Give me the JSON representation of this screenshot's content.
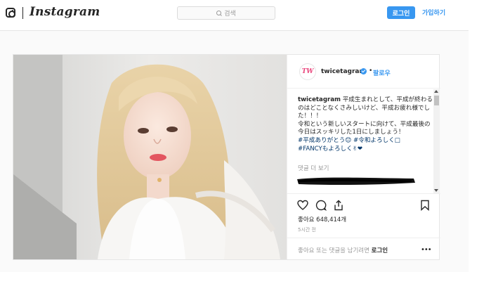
{
  "topbar": {
    "brand": "Instagram",
    "search_placeholder": "검색",
    "login_label": "로그인",
    "signup_label": "가입하기"
  },
  "post": {
    "avatar_text": "TW",
    "username": "twicetagram",
    "follow_label": "팔로우",
    "separator": "•",
    "caption": {
      "author": "twicetagram",
      "lines": [
        "平成生まれとして、平成が終わるのはどことなくさみしいけど、平成お疲れ様でした！！！",
        "令和という新しいスタートに向けて、平成最後の今日はスッキリした1日にしましょう！"
      ],
      "hashtag_line1": "#平成ありがとう😊 #令和よろしく□",
      "hashtag_line2": "#FANCYもよろしく✌❤"
    },
    "view_comments": "댓글 더 보기",
    "likes_text": "좋아요 648,414개",
    "time_ago": "5시간 전",
    "comment_prompt": "좋아요 또는 댓글을 남기려면",
    "comment_login": "로그인",
    "more_icon": "more-icon"
  },
  "colors": {
    "accent": "#3897f0",
    "text": "#262626",
    "muted": "#999999",
    "border": "#efefef"
  }
}
